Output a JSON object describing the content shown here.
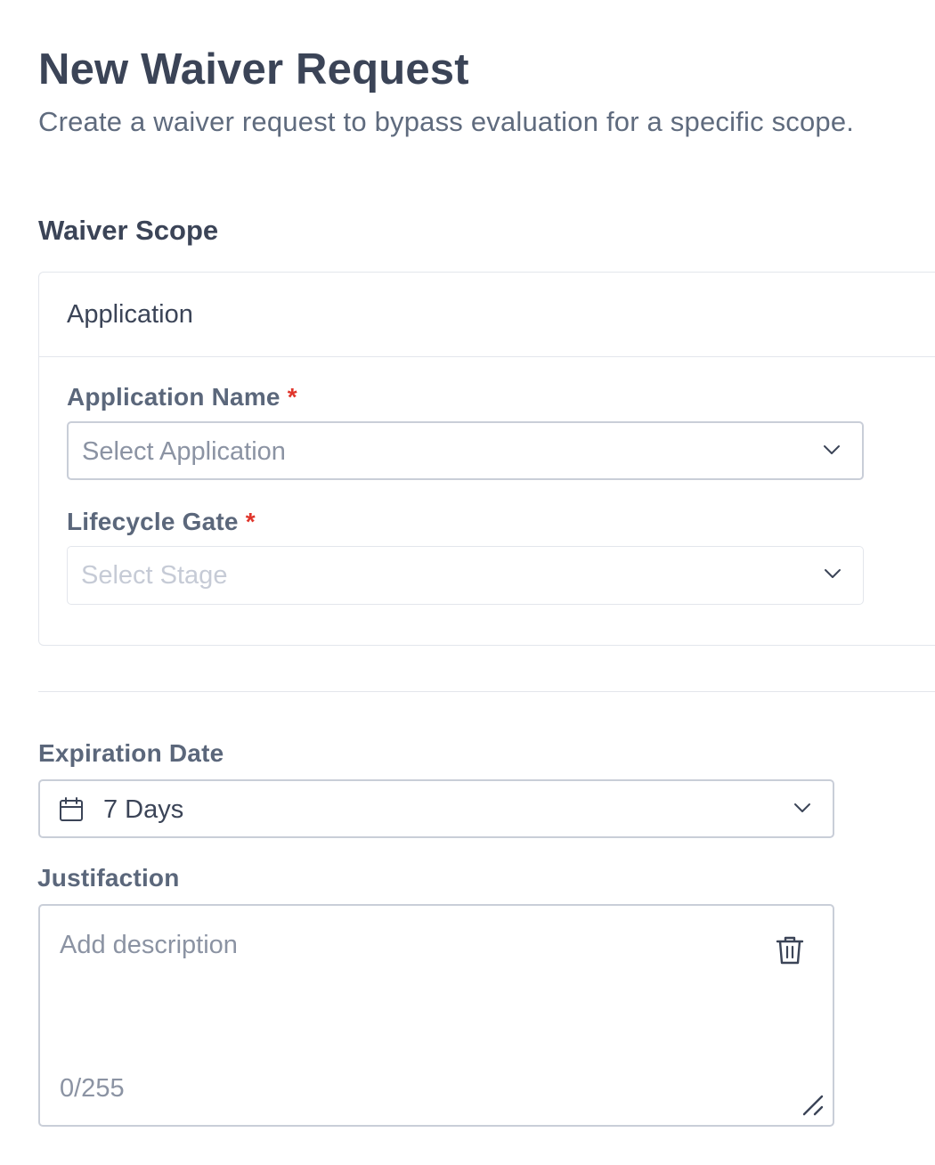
{
  "header": {
    "title": "New Waiver Request",
    "subtitle": "Create a waiver request to bypass evaluation for a specific scope."
  },
  "scope": {
    "section_title": "Waiver Scope",
    "card_header": "Application",
    "application_name": {
      "label": "Application Name",
      "required_mark": "*",
      "placeholder": "Select Application",
      "icon": "chevron-down-icon"
    },
    "lifecycle_gate": {
      "label": "Lifecycle Gate",
      "required_mark": "*",
      "placeholder": "Select Stage",
      "disabled": true,
      "icon": "chevron-down-icon"
    }
  },
  "expiration": {
    "label": "Expiration Date",
    "value": "7 Days",
    "icon": "calendar-icon",
    "dropdown_icon": "chevron-down-icon"
  },
  "justification": {
    "label": "Justifaction",
    "placeholder": "Add description",
    "counter": "0/255",
    "clear_icon": "trash-icon",
    "resize_icon": "resize-handle-icon"
  },
  "colors": {
    "text_primary": "#3b4457",
    "text_secondary": "#5f6b7e",
    "placeholder": "#8b93a3",
    "disabled_placeholder": "#c6cbd6",
    "border": "#c9ced8",
    "border_light": "#e3e6ec",
    "required": "#e0352b"
  }
}
